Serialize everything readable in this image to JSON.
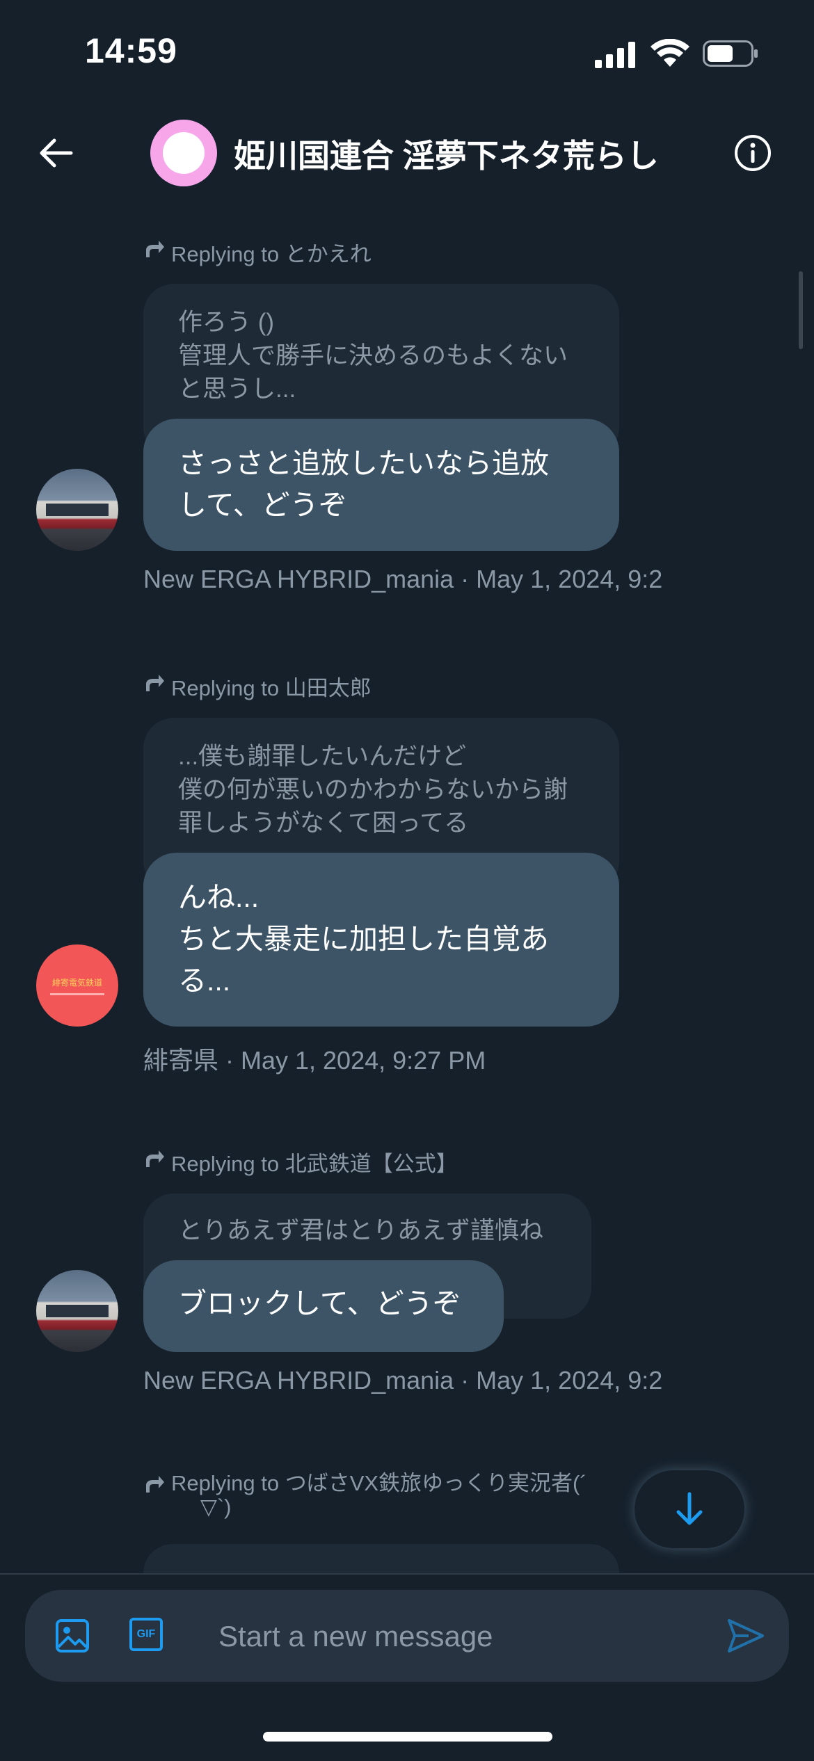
{
  "status_bar": {
    "time": "14:59"
  },
  "header": {
    "title": "姫川国連合 淫夢下ネタ荒らし"
  },
  "messages": [
    {
      "reply_to": "Replying to とかえれ",
      "quote": [
        "作ろう ()",
        "管理人で勝手に決めるのもよくない",
        "と思うし..."
      ],
      "text": [
        "さっさと追放したいなら追放",
        "して、どうぞ"
      ],
      "meta": "New ERGA HYBRID_mania · May 1, 2024, 9:2",
      "avatar": "bus-avatar"
    },
    {
      "reply_to": "Replying to 山田太郎",
      "quote": [
        "...僕も謝罪したいんだけど",
        "僕の何が悪いのかわからないから謝",
        "罪しようがなくて困ってる"
      ],
      "text": [
        "んね...",
        "ちと大暴走に加担した自覚あ",
        "る..."
      ],
      "meta": "緋寄県 · May 1, 2024, 9:27 PM",
      "avatar": "red-avatar"
    },
    {
      "reply_to": "Replying to 北武鉄道【公式】",
      "quote": [
        "とりあえず君はとりあえず謹慎ね"
      ],
      "text": [
        "ブロックして、どうぞ"
      ],
      "meta": "New ERGA HYBRID_mania · May 1, 2024, 9:2",
      "avatar": "bus-avatar"
    },
    {
      "reply_to": [
        "Replying to つばさVX鉄旅ゆっくり実況者(´",
        "▽`)"
      ]
    }
  ],
  "composer": {
    "placeholder": "Start a new message",
    "image_icon": "image-icon",
    "gif_label": "GIF",
    "send_icon": "send-icon"
  },
  "colors": {
    "background": "#15202b",
    "bubble": "#3d5466",
    "quote": "#1e2a36",
    "accent": "#1d9bf0",
    "muted": "#8b98a5"
  }
}
